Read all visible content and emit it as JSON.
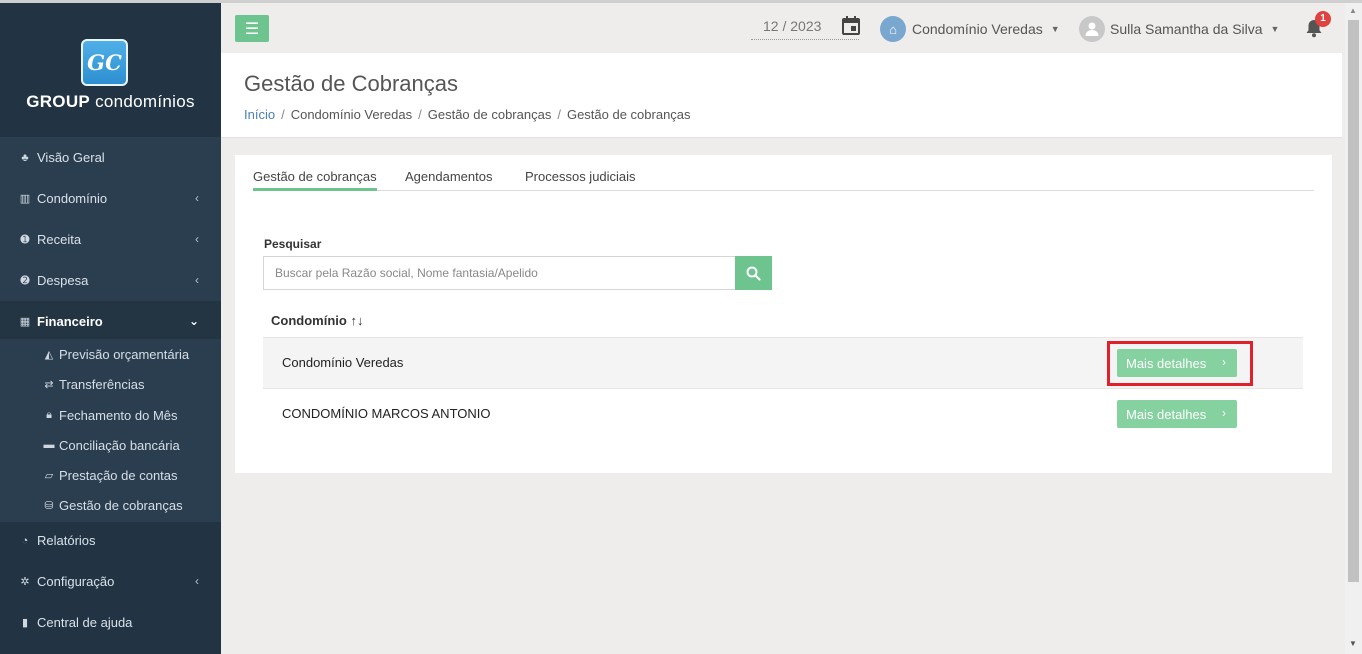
{
  "brand": {
    "logo_text": "GC",
    "name_bold": "GROUP",
    "name_rest": "condomínios"
  },
  "sidebar": {
    "items": [
      {
        "label": "Visão Geral",
        "icon": "dashboard-icon"
      },
      {
        "label": "Condomínio",
        "icon": "building-icon"
      },
      {
        "label": "Receita",
        "icon": "arrow-up-circle-icon"
      },
      {
        "label": "Despesa",
        "icon": "arrow-down-circle-icon"
      },
      {
        "label": "Financeiro",
        "icon": "calculator-icon"
      },
      {
        "label": "Relatórios",
        "icon": "pie-chart-icon"
      },
      {
        "label": "Configuração",
        "icon": "gear-icon"
      },
      {
        "label": "Central de ajuda",
        "icon": "help-book-icon"
      }
    ],
    "submenu": [
      {
        "label": "Previsão orçamentária",
        "icon": "area-chart-icon"
      },
      {
        "label": "Transferências",
        "icon": "exchange-icon"
      },
      {
        "label": "Fechamento do Mês",
        "icon": "lock-icon"
      },
      {
        "label": "Conciliação bancária",
        "icon": "credit-card-icon"
      },
      {
        "label": "Prestação de contas",
        "icon": "folder-open-icon"
      },
      {
        "label": "Gestão de cobranças",
        "icon": "coins-icon"
      }
    ]
  },
  "topbar": {
    "date": "12 / 2023",
    "condo": "Condomínio Veredas",
    "user": "Sulla Samantha da Silva",
    "notification_count": "1"
  },
  "header": {
    "title": "Gestão de Cobranças",
    "breadcrumb": [
      "Início",
      "Condomínio Veredas",
      "Gestão de cobranças",
      "Gestão de cobranças"
    ]
  },
  "tabs": [
    "Gestão de cobranças",
    "Agendamentos",
    "Processos judiciais"
  ],
  "search": {
    "label": "Pesquisar",
    "placeholder": "Buscar pela Razão social, Nome fantasia/Apelido"
  },
  "table": {
    "column": "Condomínio",
    "sort_glyph": "↑↓",
    "rows": [
      {
        "name": "Condomínio Veredas",
        "action": "Mais detalhes"
      },
      {
        "name": "CONDOMÍNIO MARCOS ANTONIO",
        "action": "Mais detalhes"
      }
    ]
  },
  "colors": {
    "accent": "#6dc48f",
    "sidebar": "#2b3e50",
    "highlight": "#e0212b"
  }
}
